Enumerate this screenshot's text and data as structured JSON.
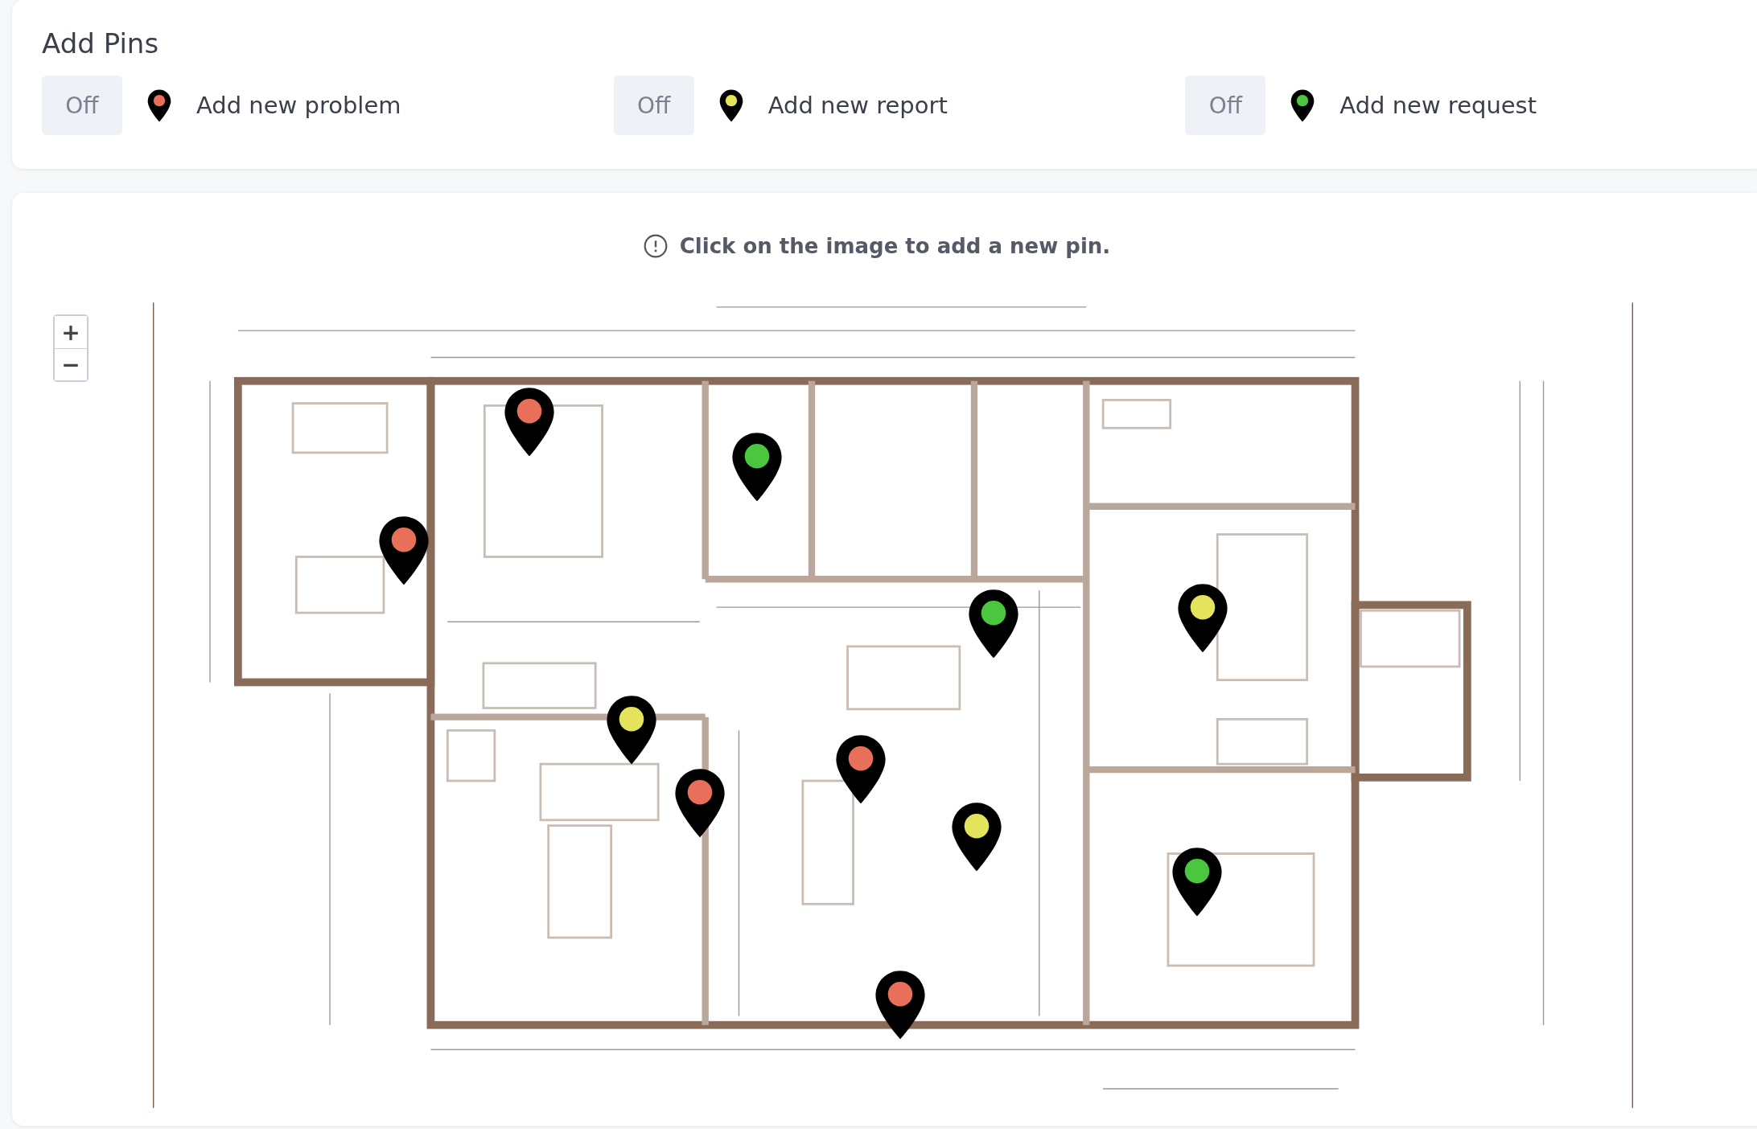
{
  "header": {
    "title": "Add Pins",
    "modes": [
      {
        "toggle": "Off",
        "on": false,
        "label": "Add new problem",
        "color": "#e8705a"
      },
      {
        "toggle": "Off",
        "on": false,
        "label": "Add new report",
        "color": "#e4e35c"
      },
      {
        "toggle": "Off",
        "on": false,
        "label": "Add new request",
        "color": "#4cc63f"
      }
    ]
  },
  "map": {
    "hint": "Click on the image to add a new pin.",
    "zoom_in": "+",
    "zoom_out": "−",
    "pins": [
      {
        "color": "#e8705a"
      },
      {
        "color": "#4cc63f"
      },
      {
        "color": "#e8705a"
      },
      {
        "color": "#4cc63f"
      },
      {
        "color": "#e4e35c"
      },
      {
        "color": "#e4e35c"
      },
      {
        "color": "#e8705a"
      },
      {
        "color": "#e8705a"
      },
      {
        "color": "#e4e35c"
      },
      {
        "color": "#4cc63f"
      },
      {
        "color": "#e8705a"
      }
    ]
  }
}
